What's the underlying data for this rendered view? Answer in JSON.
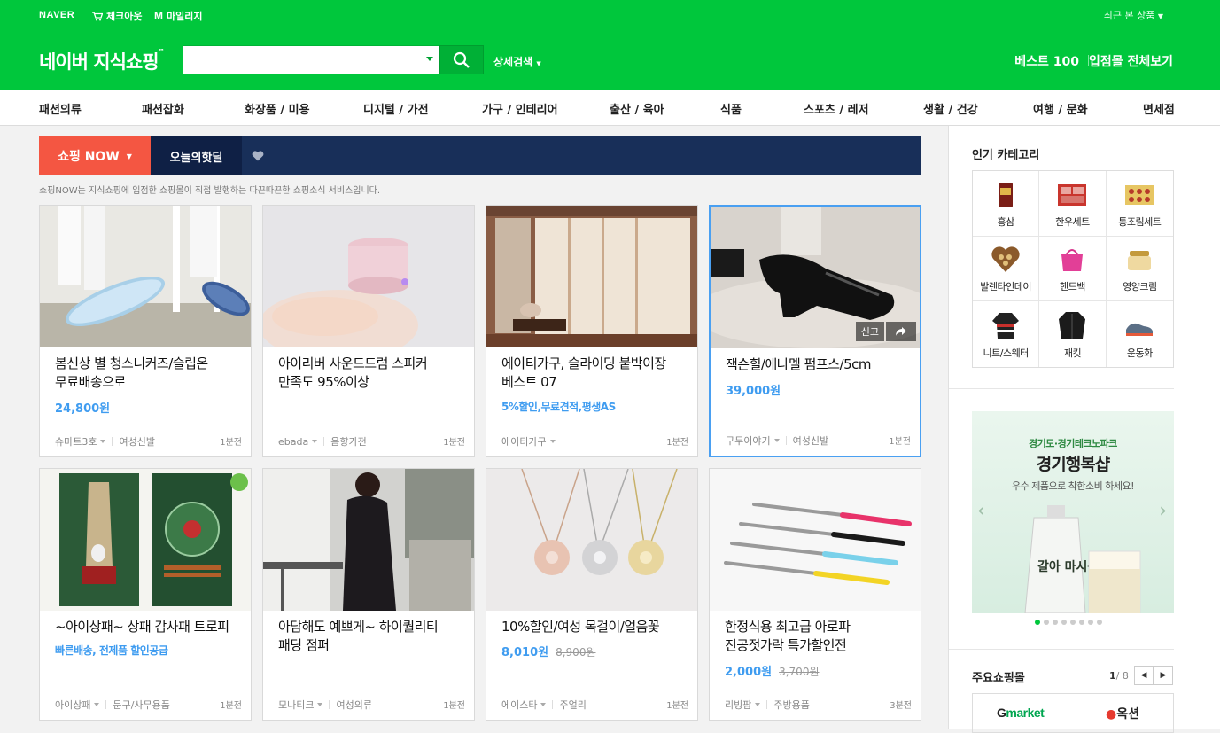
{
  "top": {
    "naver": "NAVER",
    "checkout": "체크아웃",
    "mileage": "마일리지",
    "recent": "최근 본 상품"
  },
  "header": {
    "logo": "네이버 지식쇼핑",
    "logo_mark": "™",
    "search_value": "",
    "adv_search": "상세검색",
    "best100": "베스트 100",
    "all_malls": "입점몰 전체보기"
  },
  "categories": [
    "패션의류",
    "패션잡화",
    "화장품 / 미용",
    "디지털 / 가전",
    "가구 / 인테리어",
    "출산 / 육아",
    "식품",
    "스포츠 / 레저",
    "생활 / 건강",
    "여행 / 문화",
    "면세점"
  ],
  "tabs": {
    "now": "쇼핑 NOW",
    "deal": "오늘의핫딜"
  },
  "notice": "쇼핑NOW는 지식쇼핑에 입점한 쇼핑몰이 직접 발행하는 따끈따끈한 쇼핑소식 서비스입니다.",
  "products": [
    {
      "title": "봄신상 별 청스니커즈/슬립온 무료배송으로",
      "price": "24,800원",
      "orig": "",
      "promo": "",
      "mall": "슈마트3호",
      "category": "여성신발",
      "time": "1분전",
      "img": "sneakers"
    },
    {
      "title": "아이리버 사운드드럼 스피커 만족도 95%이상",
      "price": "",
      "orig": "",
      "promo": "",
      "mall": "ebada",
      "category": "음향가전",
      "time": "1분전",
      "img": "speaker"
    },
    {
      "title": "에이티가구, 슬라이딩 붙박이장 베스트 07",
      "price": "",
      "orig": "",
      "promo": "5%할인,무료견적,평생AS",
      "mall": "에이티가구",
      "category": "",
      "time": "1분전",
      "img": "closet"
    },
    {
      "title": "잭슨힐/에나멜 펌프스/5cm",
      "price": "39,000원",
      "orig": "",
      "promo": "",
      "mall": "구두이야기",
      "category": "여성신발",
      "time": "1분전",
      "img": "pumps",
      "report": "신고"
    },
    {
      "title": "~아이상패~ 상패 감사패 트로피",
      "price": "",
      "orig": "",
      "promo": "빠른배송, 전제품 할인공급",
      "mall": "아이상패",
      "category": "문구/사무용품",
      "time": "1분전",
      "img": "trophy"
    },
    {
      "title": "아담해도 예쁘게~ 하이퀄리티 패딩 점퍼",
      "price": "",
      "orig": "",
      "promo": "",
      "mall": "모나티크",
      "category": "여성의류",
      "time": "1분전",
      "img": "padding"
    },
    {
      "title": "10%할인/여성 목걸이/얼음꽃",
      "price": "8,010원",
      "orig": "8,900원",
      "promo": "",
      "mall": "에이스타",
      "category": "주얼리",
      "time": "1분전",
      "img": "necklace"
    },
    {
      "title": "한정식용 최고급 아로파 진공젓가락 특가할인전",
      "price": "2,000원",
      "orig": "3,700원",
      "promo": "",
      "mall": "리빙팜",
      "category": "주방용품",
      "time": "3분전",
      "img": "chopsticks"
    }
  ],
  "popular": {
    "title": "인기 카테고리",
    "items": [
      "홍삼",
      "한우세트",
      "통조림세트",
      "발렌타인데이",
      "핸드백",
      "영양크림",
      "니트/스웨터",
      "재킷",
      "운동화"
    ]
  },
  "banner": {
    "line1": "경기도·경기테크노파크",
    "line2": "경기행복샵",
    "line3": "우수 제품으로 착한소비 하세요!",
    "pouch_text": "갈아 마시는"
  },
  "malls": {
    "title": "주요쇼핑몰",
    "page": "1",
    "total": "/ 8",
    "gmarket": "market",
    "gmarket_g": "G",
    "auction": "옥션"
  },
  "colors": {
    "brand": "#00c73c",
    "price": "#3f9cf0",
    "now": "#f45642",
    "tabbar": "#182f59"
  }
}
